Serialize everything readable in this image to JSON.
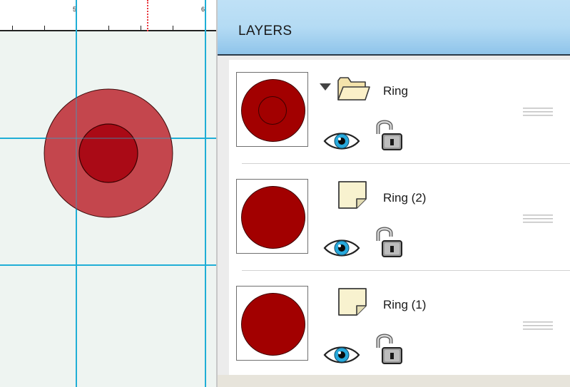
{
  "ruler": {
    "labels": [
      "5",
      "6"
    ]
  },
  "panel": {
    "title": "LAYERS",
    "layers": [
      {
        "name": "Ring",
        "type": "group",
        "expanded": true,
        "visible": true,
        "locked": false
      },
      {
        "name": "Ring (2)",
        "type": "shape",
        "visible": true,
        "locked": false
      },
      {
        "name": "Ring (1)",
        "type": "shape",
        "visible": true,
        "locked": false
      }
    ]
  },
  "colors": {
    "layer_fill": "#a20000",
    "outer_ring_fill": "#c4464d",
    "guide": "#1faed6",
    "header": "#b4dbf4"
  },
  "icons": {
    "disclosure": "disclosure-triangle-icon",
    "group": "folder-icon",
    "shape": "document-icon",
    "visibility": "eye-icon",
    "lock": "unlocked-padlock-icon",
    "drag": "drag-handle-icon"
  }
}
